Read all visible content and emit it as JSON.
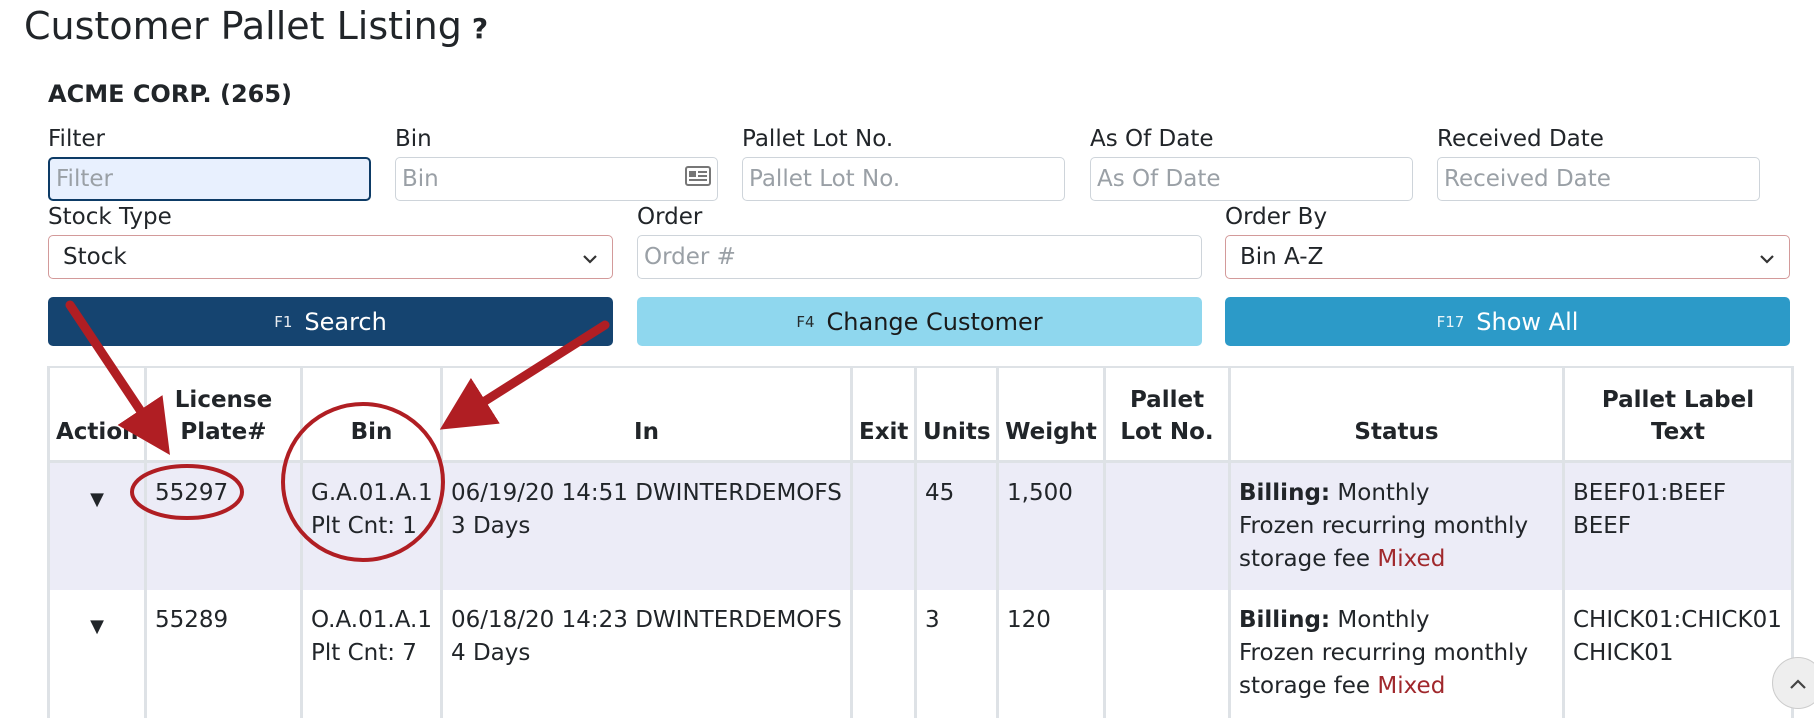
{
  "page": {
    "title": "Customer Pallet Listing",
    "help_symbol": "?",
    "customer": "ACME CORP. (265)"
  },
  "filters": {
    "filter": {
      "label": "Filter",
      "placeholder": "Filter"
    },
    "bin": {
      "label": "Bin",
      "placeholder": "Bin",
      "icon": "id-card-icon"
    },
    "pallet_lot": {
      "label": "Pallet Lot No.",
      "placeholder": "Pallet Lot No."
    },
    "as_of_date": {
      "label": "As Of Date",
      "placeholder": "As Of Date"
    },
    "received_date": {
      "label": "Received Date",
      "placeholder": "Received Date"
    },
    "stock_type": {
      "label": "Stock Type",
      "value": "Stock"
    },
    "order": {
      "label": "Order",
      "placeholder": "Order #"
    },
    "order_by": {
      "label": "Order By",
      "value": "Bin A-Z"
    }
  },
  "buttons": {
    "search": {
      "key": "F1",
      "label": "Search"
    },
    "change_customer": {
      "key": "F4",
      "label": "Change Customer"
    },
    "show_all": {
      "key": "F17",
      "label": "Show All"
    }
  },
  "table": {
    "headers": {
      "action": "Action",
      "license_line1": "License",
      "license_line2": "Plate#",
      "bin": "Bin",
      "in": "In",
      "exit": "Exit",
      "units": "Units",
      "weight": "Weight",
      "lot_line1": "Pallet",
      "lot_line2": "Lot No.",
      "status": "Status",
      "label_text": "Pallet Label Text"
    },
    "rows": [
      {
        "license": "55297",
        "bin": "G.A.01.A.1",
        "plt_cnt": "Plt Cnt: 1",
        "in": "06/19/20 14:51 DWINTERDEMOFS",
        "days": "3 Days",
        "exit": "",
        "units": "45",
        "weight": "1,500",
        "lot": "",
        "billing_label": "Billing:",
        "billing_value": "Monthly",
        "status_line2": "Frozen recurring monthly",
        "status_line3": "storage fee",
        "status_flag": "Mixed",
        "label_line1": "BEEF01:BEEF",
        "label_line2": "BEEF"
      },
      {
        "license": "55289",
        "bin": "O.A.01.A.1",
        "plt_cnt": "Plt Cnt: 7",
        "in": "06/18/20 14:23 DWINTERDEMOFS",
        "days": "4 Days",
        "exit": "",
        "units": "3",
        "weight": "120",
        "lot": "",
        "billing_label": "Billing:",
        "billing_value": "Monthly",
        "status_line2": "Frozen recurring monthly",
        "status_line3": "storage fee",
        "status_flag": "Mixed",
        "label_line1": "CHICK01:CHICK01",
        "label_line2": "CHICK01"
      }
    ]
  },
  "colors": {
    "search_button": "#154470",
    "change_customer_button": "#8fd7ee",
    "show_all_button": "#2c9ac8",
    "annotation": "#b01e23",
    "mixed_text": "#a0282c",
    "row_highlight": "#ececf7"
  }
}
